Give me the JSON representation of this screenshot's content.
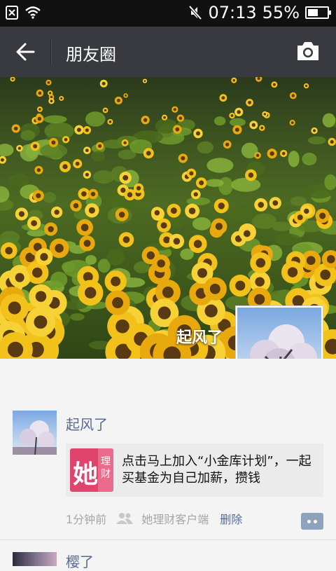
{
  "status_bar": {
    "time": "07:13",
    "battery_text": "55%",
    "battery_level": 0.55,
    "icons": [
      "notification-x-icon",
      "wifi-icon",
      "mute-icon",
      "battery-icon"
    ]
  },
  "header": {
    "title": "朋友圈",
    "back_icon": "back-arrow-icon",
    "camera_icon": "camera-icon",
    "background": "#393a3f"
  },
  "cover": {
    "user_name": "起风了"
  },
  "posts": [
    {
      "user": "起风了",
      "share": {
        "icon_text": "她",
        "icon_small_text": "理财",
        "text": "点击马上加入“小金库计划”，一起买基金为自己加薪，攒钱"
      },
      "time": "1分钟前",
      "source": "她理财客户端",
      "delete_label": "删除"
    },
    {
      "user": "樱了"
    }
  ],
  "colors": {
    "link": "#576b95",
    "share_icon": "#e0446d",
    "meta_text": "#a6a6a6"
  }
}
